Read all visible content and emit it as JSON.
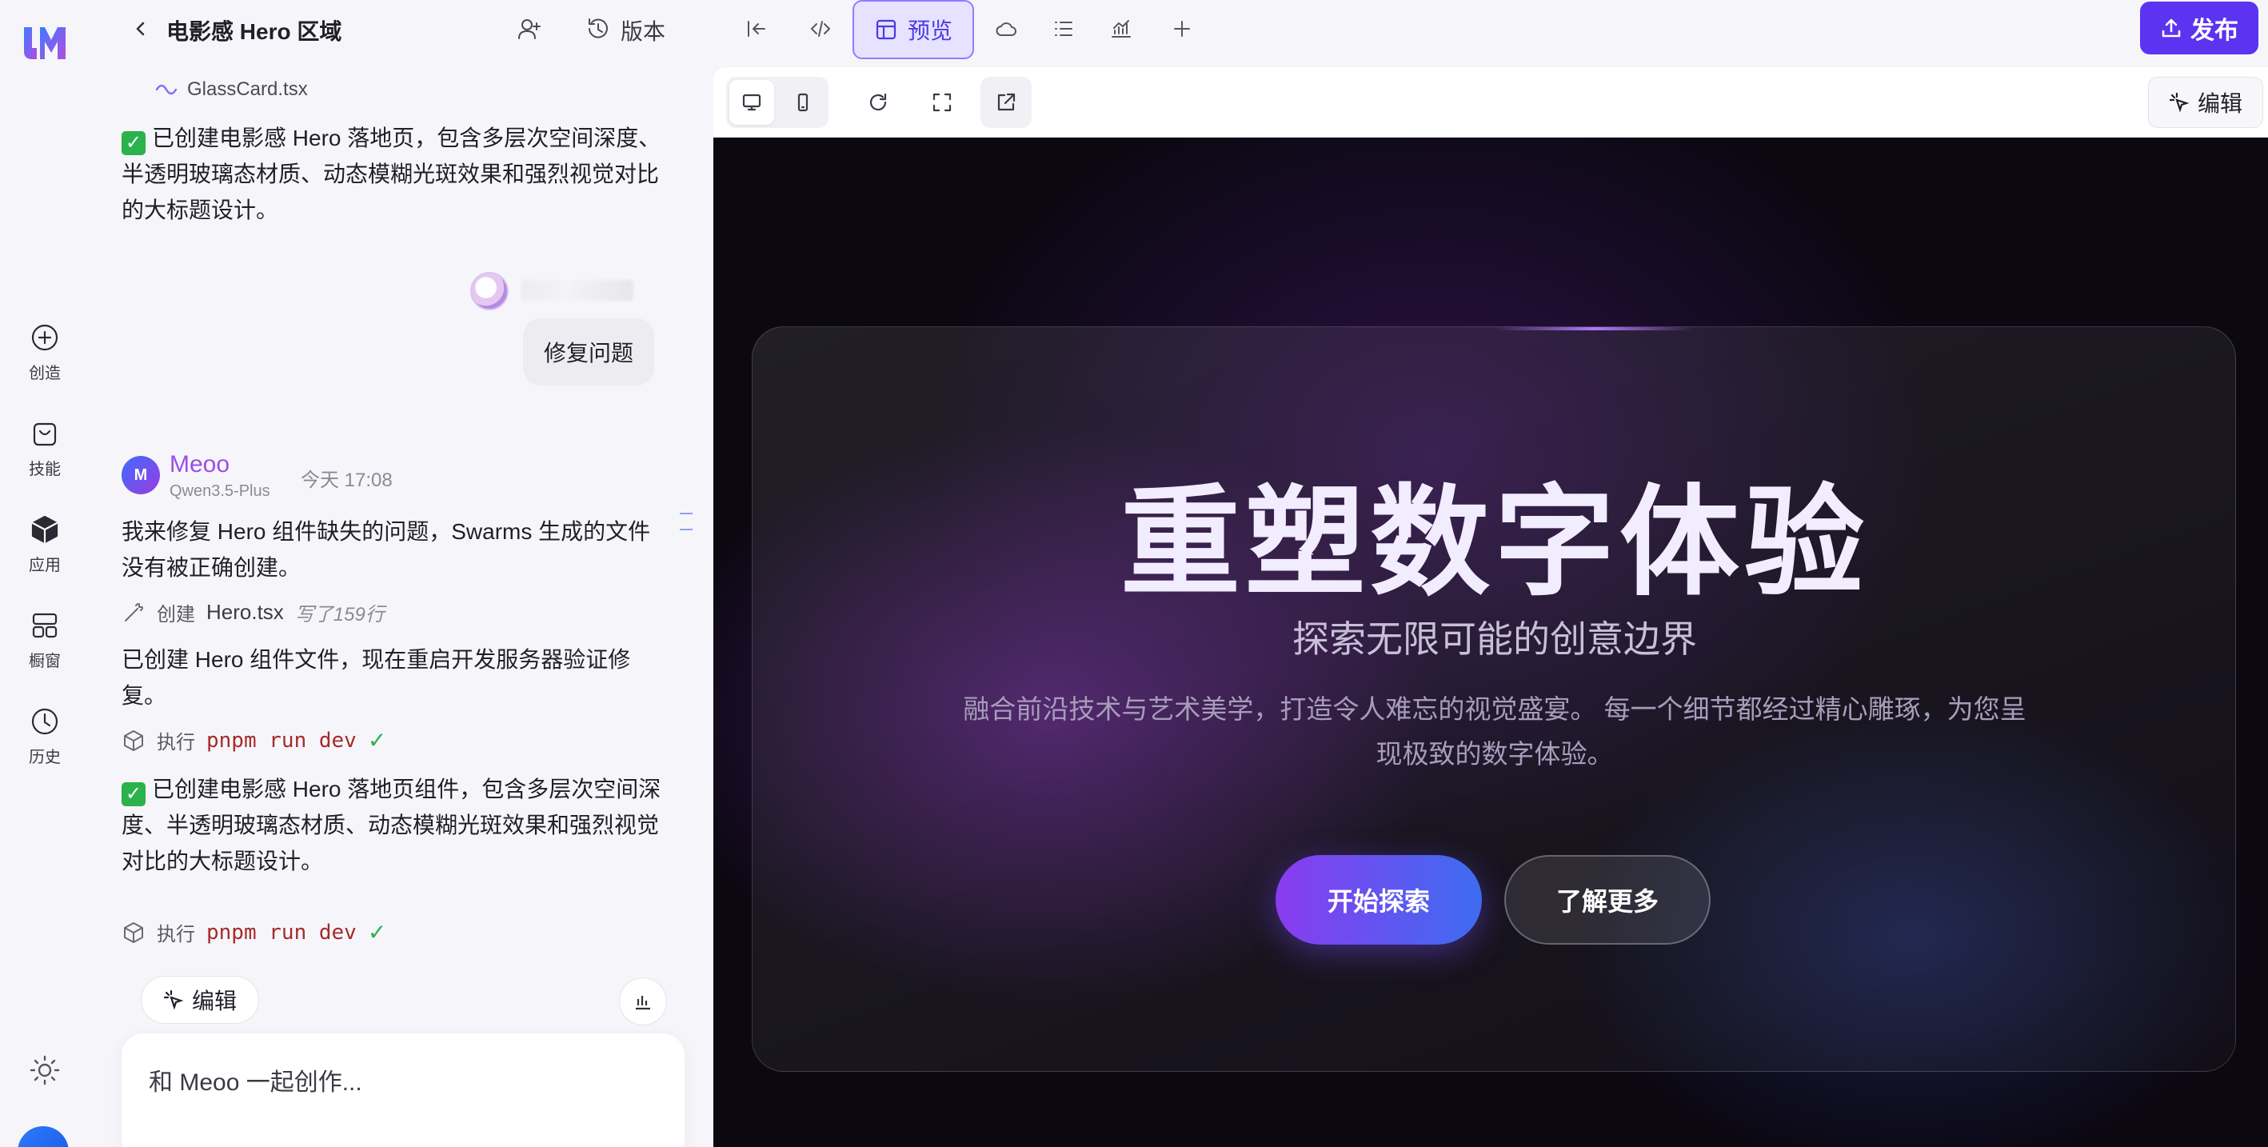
{
  "rail": {
    "items": [
      {
        "label": "创造",
        "icon": "plus-circle-icon"
      },
      {
        "label": "技能",
        "icon": "bag-icon"
      },
      {
        "label": "应用",
        "icon": "cube-icon"
      },
      {
        "label": "橱窗",
        "icon": "grid-icon"
      },
      {
        "label": "历史",
        "icon": "clock-icon"
      }
    ]
  },
  "header": {
    "title": "电影感 Hero 区域",
    "version_label": "版本",
    "preview_tab": "预览",
    "publish": "发布"
  },
  "chat": {
    "file_chip": "GlassCard.tsx",
    "summary_1": "已创建电影感 Hero 落地页，包含多层次空间深度、半透明玻璃态材质、动态模糊光斑效果和强烈视觉对比的大标题设计。",
    "user_message": "修复问题",
    "bot": {
      "name": "Meoo",
      "model": "Qwen3.5-Plus",
      "time": "今天 17:08",
      "avatar_text": "M"
    },
    "reply_1": "我来修复 Hero 组件缺失的问题，Swarms 生成的文件没有被正确创建。",
    "create_action": {
      "verb": "创建",
      "file": "Hero.tsx",
      "meta": "写了159行"
    },
    "reply_2": "已创建 Hero 组件文件，现在重启开发服务器验证修复。",
    "exec_action": {
      "verb": "执行",
      "command": "pnpm run dev"
    },
    "summary_2": "已创建电影感 Hero 落地页组件，包含多层次空间深度、半透明玻璃态材质、动态模糊光斑效果和强烈视觉对比的大标题设计。",
    "exec_action_2": {
      "verb": "执行",
      "command": "pnpm run dev"
    },
    "edit_chip": "编辑",
    "composer_placeholder": "和 Meoo 一起创作..."
  },
  "preview": {
    "edit_label": "编辑",
    "hero": {
      "title": "重塑数字体验",
      "subtitle": "探索无限可能的创意边界",
      "description": "融合前沿技术与艺术美学，打造令人难忘的视觉盛宴。 每一个细节都经过精心雕琢，为您呈现极致的数字体验。",
      "primary_cta": "开始探索",
      "secondary_cta": "了解更多"
    }
  },
  "colors": {
    "accent": "#5b33f0",
    "preview_tab_bg": "#e6e2ff",
    "bot_name": "#9c4de8",
    "success": "#2bb24c"
  }
}
